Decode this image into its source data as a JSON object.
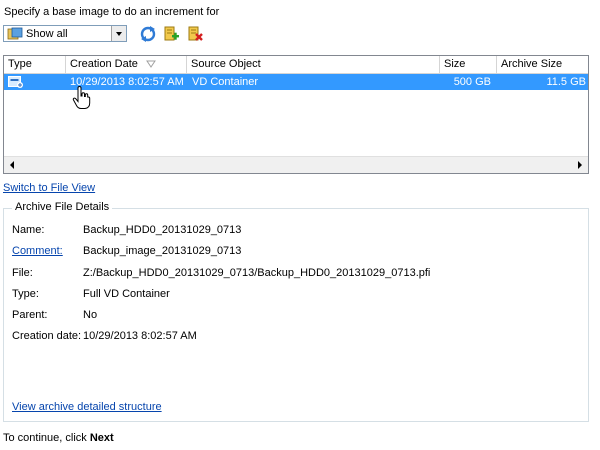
{
  "header": {
    "text": "Specify a base image to do an increment for"
  },
  "toolbar": {
    "filter_value": "Show all",
    "icons": [
      "refresh-icon",
      "add-archive-icon",
      "delete-archive-icon"
    ]
  },
  "table": {
    "columns": [
      "Type",
      "Creation Date",
      "Source Object",
      "Size",
      "Archive Size"
    ],
    "sort_column": "Creation Date",
    "rows": [
      {
        "creation_date": "10/29/2013 8:02:57 AM",
        "source_object": "VD Container",
        "size": "500 GB",
        "archive_size": "11.5 GB"
      }
    ]
  },
  "switch_view_link": "Switch to File View",
  "details": {
    "legend": "Archive File Details",
    "name_label": "Name:",
    "name_value": "Backup_HDD0_20131029_0713",
    "comment_label": "Comment:",
    "comment_value": "Backup_image_20131029_0713",
    "file_label": "File:",
    "file_value": "Z:/Backup_HDD0_20131029_0713/Backup_HDD0_20131029_0713.pfi",
    "type_label": "Type:",
    "type_value": "Full VD Container",
    "parent_label": "Parent:",
    "parent_value": "No",
    "creation_label": "Creation date:",
    "creation_value": "10/29/2013 8:02:57 AM",
    "structure_link": "View archive detailed structure"
  },
  "footer": {
    "prefix": "To continue, click ",
    "action": "Next"
  },
  "colors": {
    "selection": "#3399ff",
    "link": "#0645ad",
    "border": "#828790"
  }
}
